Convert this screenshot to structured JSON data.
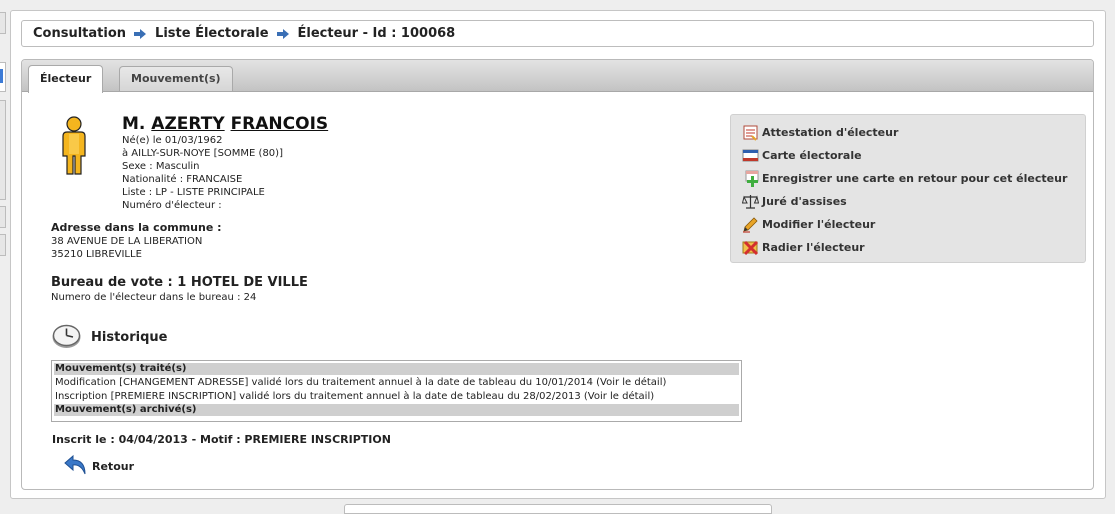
{
  "breadcrumb": {
    "items": [
      "Consultation",
      "Liste Électorale",
      "Électeur - Id : 100068"
    ]
  },
  "tabs": [
    {
      "label": "Électeur",
      "active": true
    },
    {
      "label": "Mouvement(s)",
      "active": false
    }
  ],
  "elector": {
    "civility": "M.",
    "lastname": "AZERTY",
    "firstname": "FRANCOIS",
    "birth_date": "Né(e) le 01/03/1962",
    "birth_place": "à AILLY-SUR-NOYE [SOMME (80)]",
    "sex": "Sexe : Masculin",
    "nationality": "Nationalité : FRANCAISE",
    "list": "Liste : LP - LISTE PRINCIPALE",
    "elector_number": "Numéro d'électeur :"
  },
  "address": {
    "title": "Adresse dans la commune :",
    "line1": "38 AVENUE DE LA LIBERATION",
    "line2": "35210 LIBREVILLE"
  },
  "bureau": {
    "title": "Bureau de vote : 1 HOTEL DE VILLE",
    "number": "Numero de l'électeur dans le bureau : 24"
  },
  "history": {
    "title": "Historique",
    "treated_header": "Mouvement(s) traité(s)",
    "rows": [
      "Modification [CHANGEMENT ADRESSE] validé lors du traitement annuel à la date de tableau du 10/01/2014 (Voir le détail)",
      "Inscription [PREMIERE INSCRIPTION] validé lors du traitement annuel à la date de tableau du 28/02/2013 (Voir le détail)"
    ],
    "archived_header": "Mouvement(s) archivé(s)"
  },
  "inscription": "Inscrit le : 04/04/2013 - Motif : PREMIERE INSCRIPTION",
  "back_label": "Retour",
  "actions": [
    {
      "label": "Attestation d'électeur",
      "icon": "certificate-icon"
    },
    {
      "label": "Carte électorale",
      "icon": "card-icon"
    },
    {
      "label": "Enregistrer une carte en retour pour cet électeur",
      "icon": "add-card-icon"
    },
    {
      "label": "Juré d'assises",
      "icon": "scales-icon"
    },
    {
      "label": "Modifier l'électeur",
      "icon": "edit-pencil-icon"
    },
    {
      "label": "Radier l'électeur",
      "icon": "delete-cross-icon"
    }
  ],
  "colors": {
    "avatar": "#f4b51e",
    "back_arrow": "#3a78c8",
    "nav_arrow": "#3a6fb5"
  }
}
